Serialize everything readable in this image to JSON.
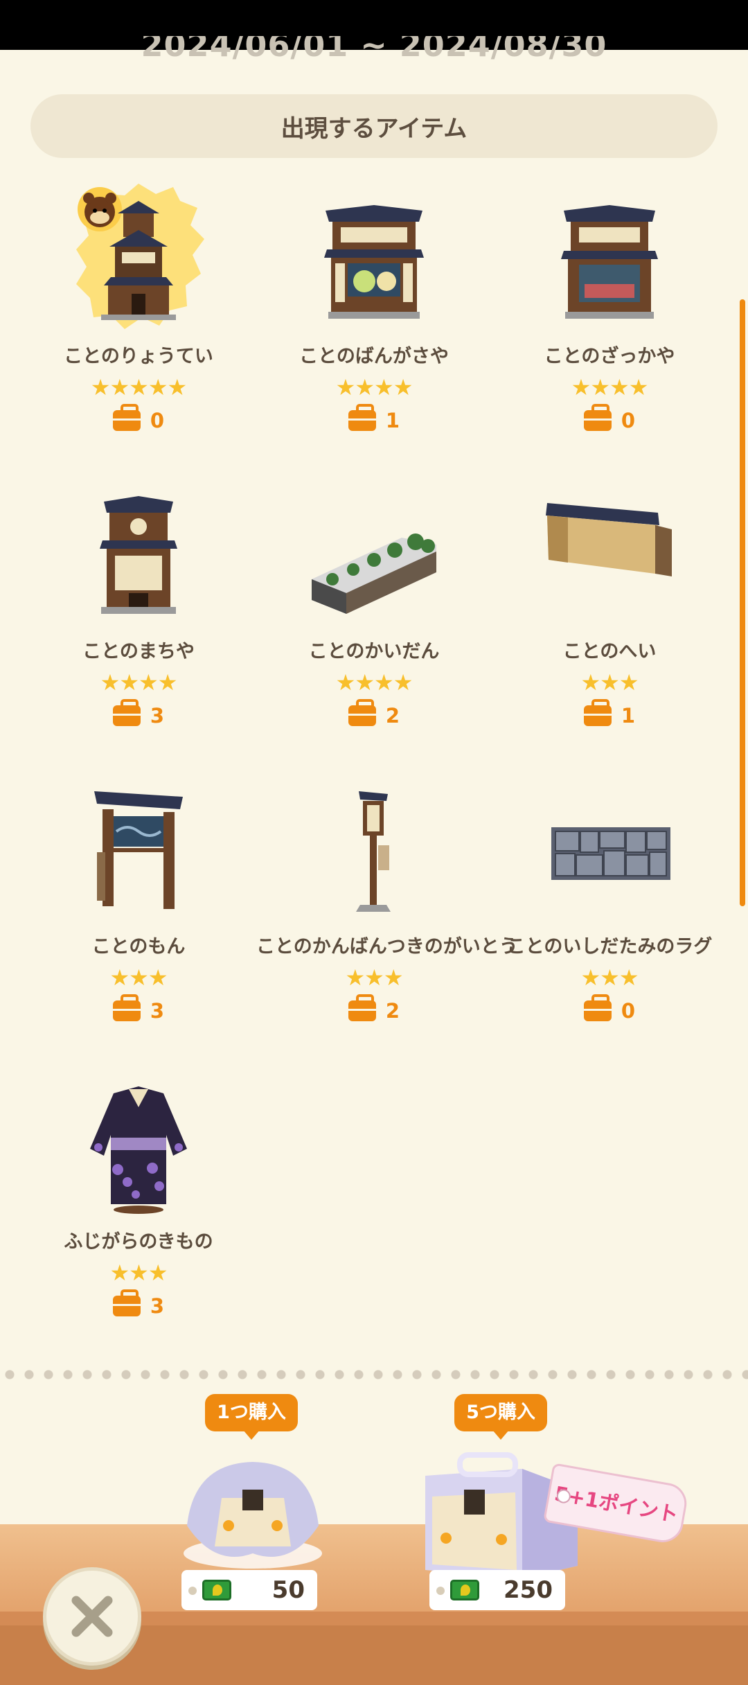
{
  "date_range": "2024/06/01 ~ 2024/08/30",
  "section_title": "出現するアイテム",
  "items": [
    {
      "name": "ことのりょうてい",
      "stars": "★★★★★",
      "count": "0"
    },
    {
      "name": "ことのばんがさや",
      "stars": "★★★★",
      "count": "1"
    },
    {
      "name": "ことのざっかや",
      "stars": "★★★★",
      "count": "0"
    },
    {
      "name": "ことのまちや",
      "stars": "★★★★",
      "count": "3"
    },
    {
      "name": "ことのかいだん",
      "stars": "★★★★",
      "count": "2"
    },
    {
      "name": "ことのへい",
      "stars": "★★★",
      "count": "1"
    },
    {
      "name": "ことのもん",
      "stars": "★★★",
      "count": "3"
    },
    {
      "name": "ことのかんばんつきのがいとう",
      "stars": "★★★",
      "count": "2"
    },
    {
      "name": "ことのいしだたみのラグ",
      "stars": "★★★",
      "count": "0"
    },
    {
      "name": "ふじがらのきもの",
      "stars": "★★★",
      "count": "3"
    }
  ],
  "purchase": {
    "single": {
      "label": "1つ購入",
      "price": "50"
    },
    "five": {
      "label": "5つ購入",
      "price": "250",
      "bonus": "5+1ポイント"
    }
  },
  "icons": {
    "currency": "leaf-ticket-icon",
    "close": "close-icon",
    "count": "bag-icon"
  }
}
